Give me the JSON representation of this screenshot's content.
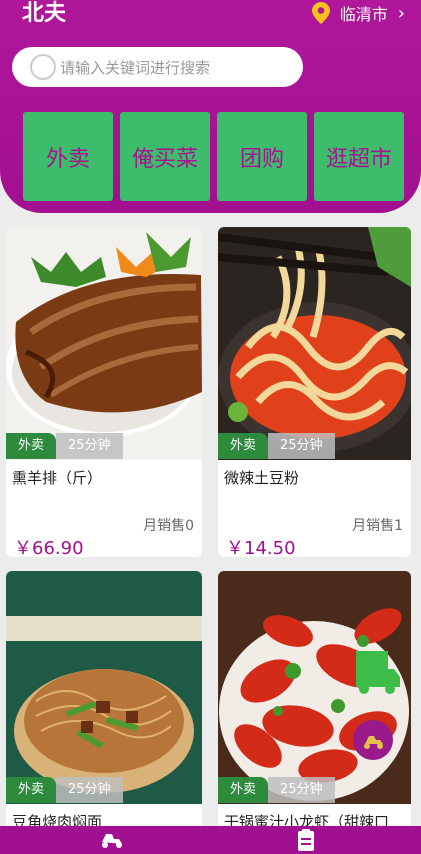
{
  "header": {
    "title": "北夫",
    "location": "临清市"
  },
  "search": {
    "placeholder": "请输入关键词进行搜索"
  },
  "categories": [
    {
      "label": "外卖"
    },
    {
      "label": "俺买菜"
    },
    {
      "label": "团购"
    },
    {
      "label": "逛超市"
    }
  ],
  "products": [
    {
      "tag": "外卖",
      "time": "25分钟",
      "name": "熏羊排（斤）",
      "sold": "月销售0",
      "price": "￥66.90"
    },
    {
      "tag": "外卖",
      "time": "25分钟",
      "name": "微辣土豆粉",
      "sold": "月销售1",
      "price": "￥14.50"
    },
    {
      "tag": "外卖",
      "time": "25分钟",
      "name": "豆角烧肉焖面",
      "sold": "",
      "price": ""
    },
    {
      "tag": "外卖",
      "time": "25分钟",
      "name": "干锅蜜汁小龙虾（甜辣口",
      "sold": "",
      "price": ""
    }
  ],
  "colors": {
    "brand": "#a11090",
    "category_bg": "#3dbc6c",
    "tag_green": "#2e8b3e"
  },
  "icons": {
    "location": "map-pin-icon",
    "nav": "chevron-right-icon",
    "search": "search-icon",
    "fab": "scooter-icon",
    "tab1": "delivery-icon",
    "tab2": "orders-icon"
  }
}
